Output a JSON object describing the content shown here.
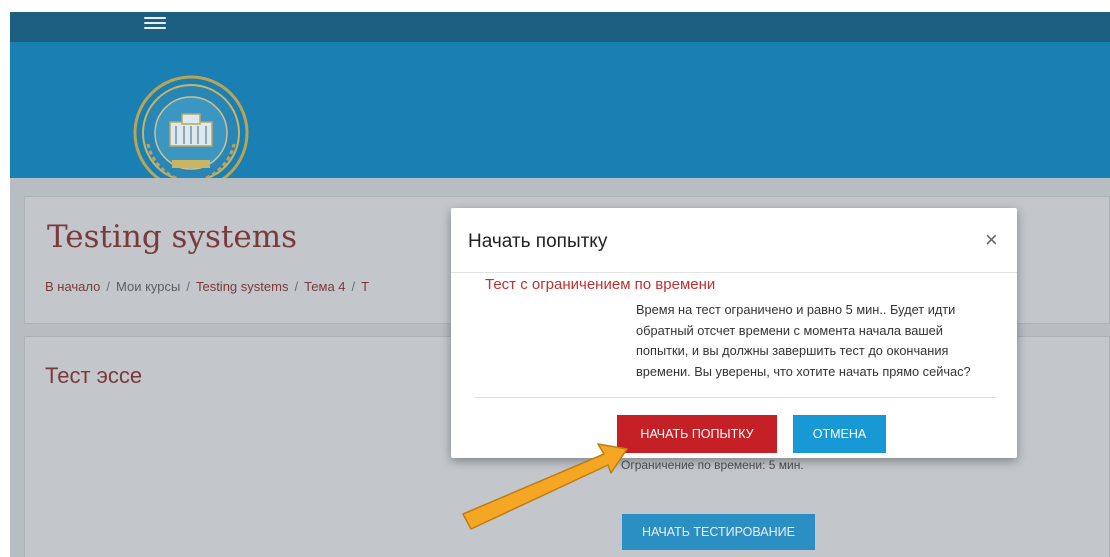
{
  "header": {
    "menu_icon": "hamburger-menu-icon"
  },
  "banner": {
    "logo_icon": "university-seal-logo"
  },
  "course": {
    "title": "Testing systems",
    "breadcrumb": [
      "В начало",
      "Мои курсы",
      "Testing systems",
      "Тема 4",
      "Т"
    ],
    "breadcrumb_separator": "/"
  },
  "quiz": {
    "title": "Тест эссе",
    "time_limit": "Ограничение по времени: 5 мин.",
    "start_button": "НАЧАТЬ ТЕСТИРОВАНИЕ"
  },
  "modal": {
    "title": "Начать попытку",
    "close": "×",
    "heading": "Тест с ограничением по времени",
    "text_lines": [
      "Время на тест ограничено и равно 5 мин.. Будет идти",
      "обратный отсчет времени с момента начала вашей",
      "попытки, и вы должны завершить тест до окончания",
      "времени. Вы уверены, что хотите начать прямо сейчас?"
    ],
    "start_button": "НАЧАТЬ ПОПЫТКУ",
    "cancel_button": "ОТМЕНА"
  },
  "colors": {
    "topbar": "#1d5f80",
    "banner": "#1a7fb2",
    "accent_red": "#c42026",
    "accent_blue": "#1799d6",
    "arrow": "#f5a623"
  }
}
